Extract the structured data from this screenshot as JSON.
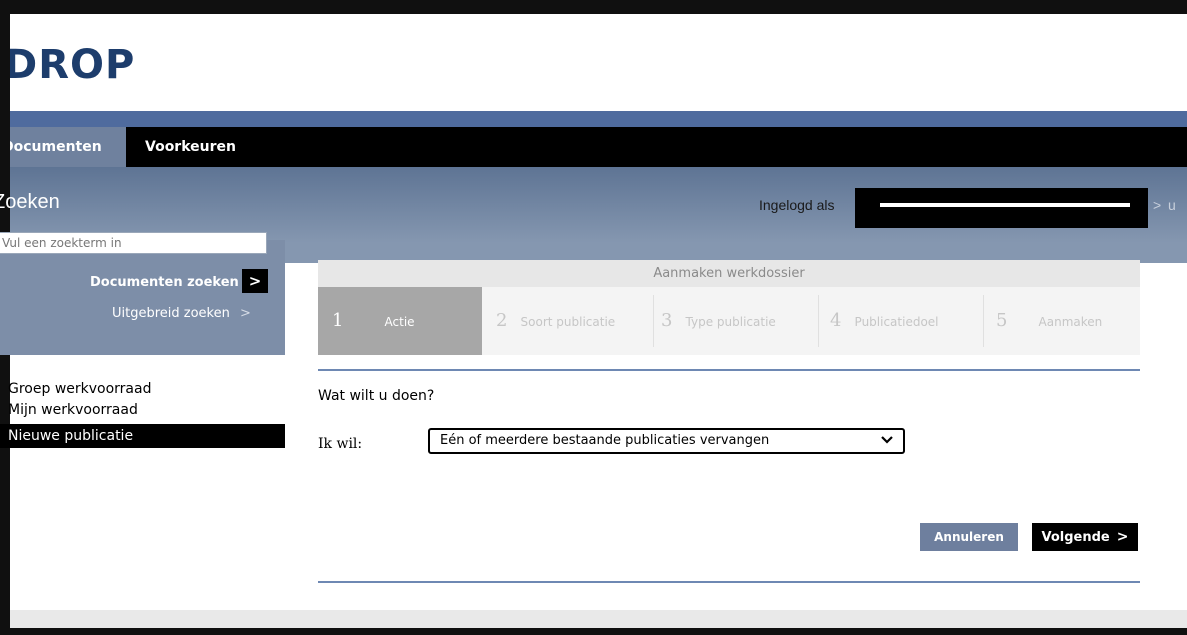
{
  "app": {
    "logo_text": "DROP"
  },
  "nav": {
    "tabs": [
      {
        "label": "Documenten",
        "active": true
      },
      {
        "label": "Voorkeuren",
        "active": false
      }
    ]
  },
  "band": {
    "title": "Zoeken",
    "logged_in_label": "Ingelogd als",
    "right_chevron": ">",
    "right_fragment": "u"
  },
  "search": {
    "placeholder": "Vul een zoekterm in",
    "button_label": "Documenten zoeken",
    "button_icon": ">",
    "advanced_label": "Uitgebreid zoeken",
    "advanced_chevron": ">"
  },
  "sidebar": {
    "items": [
      {
        "label": "Groep werkvoorraad"
      },
      {
        "label": "Mijn werkvoorraad"
      },
      {
        "label": "Nieuwe publicatie",
        "active": true
      }
    ]
  },
  "wizard": {
    "title": "Aanmaken werkdossier",
    "steps": [
      {
        "num": "1",
        "label": "Actie",
        "active": true
      },
      {
        "num": "2",
        "label": "Soort publicatie"
      },
      {
        "num": "3",
        "label": "Type publicatie"
      },
      {
        "num": "4",
        "label": "Publicatiedoel"
      },
      {
        "num": "5",
        "label": "Aanmaken"
      }
    ]
  },
  "form": {
    "question": "Wat wilt u doen?",
    "field_label": "Ik wil:",
    "selected_value": "Eén of meerdere bestaande publicaties vervangen"
  },
  "buttons": {
    "cancel": "Annuleren",
    "next": "Volgende",
    "next_icon": ">"
  },
  "colors": {
    "brand": "#1d3d6c",
    "stripe": "#4f6b9e",
    "band": "#8597b0",
    "cancel_button": "#6e7f9e",
    "active_step": "#a7a7a7"
  }
}
